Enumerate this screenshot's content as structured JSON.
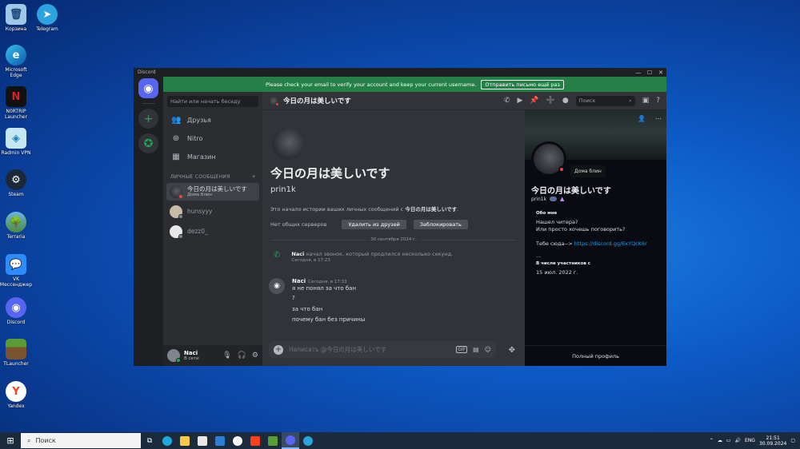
{
  "desktop": {
    "icons": [
      {
        "label": "Корзина"
      },
      {
        "label": "Telegram"
      },
      {
        "label": "Microsoft Edge"
      },
      {
        "label": "N0RTRIP Launcher"
      },
      {
        "label": "Radmin VPN"
      },
      {
        "label": "Steam"
      },
      {
        "label": "Terraria"
      },
      {
        "label": "VK Мессенджер"
      },
      {
        "label": "Discord"
      },
      {
        "label": "TLauncher"
      },
      {
        "label": "Yandex"
      }
    ]
  },
  "taskbar": {
    "search_placeholder": "Поиск",
    "lang": "ENG",
    "time": "21:51",
    "date": "30.09.2024"
  },
  "window": {
    "title": "Discord",
    "banner": {
      "text": "Please check your email to verify your account and keep your current username.",
      "button": "Отправить письмо ещё раз"
    },
    "dm": {
      "search_placeholder": "Найти или начать беседу",
      "nav": [
        {
          "label": "Друзья",
          "icon": "friends-icon"
        },
        {
          "label": "Nitro",
          "icon": "nitro-icon"
        },
        {
          "label": "Магазин",
          "icon": "shop-icon"
        }
      ],
      "section_label": "ЛИЧНЫЕ СООБЩЕНИЯ",
      "add": "+",
      "items": [
        {
          "name": "今日の月は美しいです",
          "sub": "Дома блин",
          "status_color": "#f23f43"
        },
        {
          "name": "hunsyyy",
          "sub": "",
          "status_color": "#80848e"
        },
        {
          "name": "dezz0_",
          "sub": "",
          "status_color": "#80848e"
        }
      ]
    },
    "user": {
      "name": "Naci",
      "status": "В сети"
    },
    "chat": {
      "title": "今日の月は美しいです",
      "search_placeholder": "Поиск",
      "intro_title": "今日の月は美しいです",
      "intro_username": "prin1k",
      "intro_text_prefix": "Это начало истории ваших личных сообщений с",
      "intro_text_name": "今日の月は美しいです",
      "no_common": "Нет общих серверов",
      "remove_friend": "Удалить из друзей",
      "block": "Заблокировать",
      "date_divider": "30 сентября 2024 г.",
      "call": {
        "author": "Naci",
        "text": "начал звонок, который продлился несколько секунд.",
        "time": "Сегодня, в 17:23"
      },
      "message": {
        "author": "Naci",
        "time": "Сегодня, в 17:33",
        "lines": [
          "я не понял за что бан",
          "?",
          "за что бан",
          "почему бан без причины"
        ]
      },
      "composer_placeholder": "Написать @今日の月は美しいです"
    },
    "profile": {
      "name": "今日の月は美しいです",
      "username": "prin1k",
      "tooltip": "Дома блин",
      "about_label": "Обо мне",
      "about_lines": [
        "Нашел читера?",
        "Или просто хочешь поговорить?",
        "",
        "Тебе сюда-->"
      ],
      "link": "https://discord.gg/ExYQcK6r",
      "ellipsis": "...",
      "member_since_label": "В числе участников с",
      "member_since": "15 июл. 2022 г.",
      "full_profile": "Полный профиль"
    }
  }
}
